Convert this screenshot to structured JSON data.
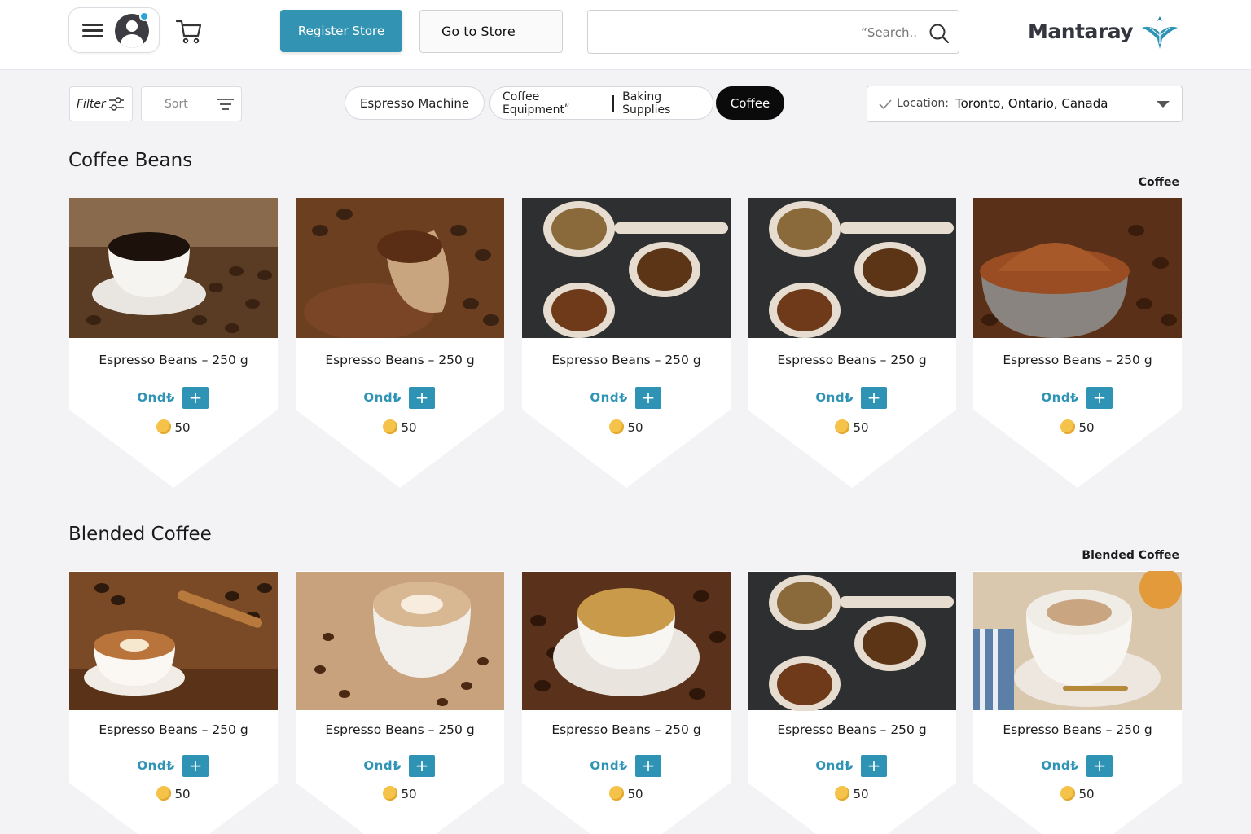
{
  "header": {
    "register_label": "Register Store",
    "go_store_label": "Go to Store",
    "search_placeholder": "“Search..",
    "brand_name": "Mantaray",
    "brand_color": "#2f93b6"
  },
  "toolbar": {
    "filter_label": "Filter",
    "sort_label": "Sort",
    "categories": [
      "Espresso Machine",
      "Coffee Equipmentʺ",
      "Baking Supplies",
      "Coffee"
    ],
    "active_category": "Coffee",
    "location_label": "Location:",
    "location_value": "Toronto, Ontario, Canada"
  },
  "sections": [
    {
      "title": "Coffee Beans",
      "tag": "Coffee",
      "products": [
        {
          "name": "Espresso Beans – 250 g",
          "price": "Ond₺",
          "points": "50",
          "image": "cup-with-beans"
        },
        {
          "name": "Espresso Beans – 250 g",
          "price": "Ond₺",
          "points": "50",
          "image": "ground-coffee-scoop"
        },
        {
          "name": "Espresso Beans – 250 g",
          "price": "Ond₺",
          "points": "50",
          "image": "coffee-spoons"
        },
        {
          "name": "Espresso Beans – 250 g",
          "price": "Ond₺",
          "points": "50",
          "image": "coffee-spoons"
        },
        {
          "name": "Espresso Beans – 250 g",
          "price": "Ond₺",
          "points": "50",
          "image": "ground-coffee-bowl"
        }
      ]
    },
    {
      "title": "Blended Coffee",
      "tag": "Blended Coffee",
      "products": [
        {
          "name": "Espresso Beans – 250 g",
          "price": "Ond₺",
          "points": "50",
          "image": "latte-art"
        },
        {
          "name": "Espresso Beans – 250 g",
          "price": "Ond₺",
          "points": "50",
          "image": "latte-white-cup"
        },
        {
          "name": "Espresso Beans – 250 g",
          "price": "Ond₺",
          "points": "50",
          "image": "espresso-cup"
        },
        {
          "name": "Espresso Beans – 250 g",
          "price": "Ond₺",
          "points": "50",
          "image": "coffee-spoons"
        },
        {
          "name": "Espresso Beans – 250 g",
          "price": "Ond₺",
          "points": "50",
          "image": "cappuccino"
        }
      ]
    }
  ]
}
